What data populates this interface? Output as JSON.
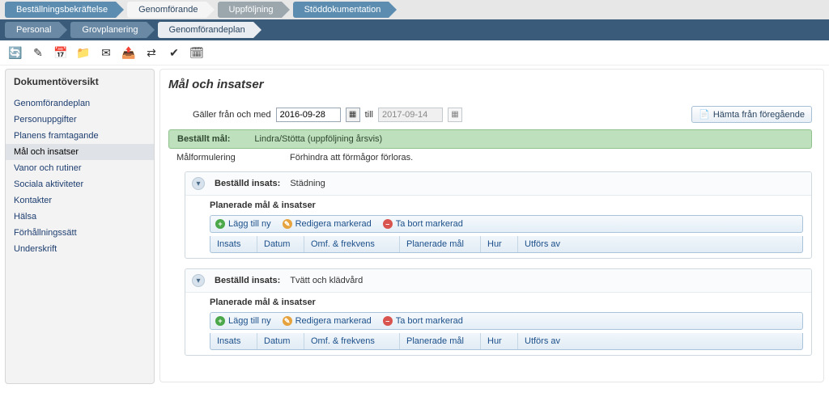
{
  "topTabs": [
    {
      "label": "Beställningsbekräftelse",
      "style": "blue"
    },
    {
      "label": "Genomförande",
      "style": "white"
    },
    {
      "label": "Uppföljning",
      "style": "gray"
    },
    {
      "label": "Stöddokumentation",
      "style": "blue"
    }
  ],
  "subTabs": [
    {
      "label": "Personal",
      "style": "plain"
    },
    {
      "label": "Grovplanering",
      "style": "plain"
    },
    {
      "label": "Genomförandeplan",
      "style": "sel"
    }
  ],
  "toolbarIcons": [
    {
      "name": "refresh-icon",
      "glyph": "🔄"
    },
    {
      "name": "edit-icon",
      "glyph": "✎"
    },
    {
      "name": "calendar-icon",
      "glyph": "📅"
    },
    {
      "name": "folder-icon",
      "glyph": "📁"
    },
    {
      "name": "mail-icon",
      "glyph": "✉"
    },
    {
      "name": "export-icon",
      "glyph": "📤"
    },
    {
      "name": "exchange-icon",
      "glyph": "⇄"
    },
    {
      "name": "check-icon",
      "glyph": "✔"
    },
    {
      "name": "schedule-icon",
      "glyph": "🗓"
    }
  ],
  "sidebar": {
    "title": "Dokumentöversikt",
    "items": [
      "Genomförandeplan",
      "Personuppgifter",
      "Planens framtagande",
      "Mål och insatser",
      "Vanor och rutiner",
      "Sociala aktiviteter",
      "Kontakter",
      "Hälsa",
      "Förhållningssätt",
      "Underskrift"
    ],
    "activeIndex": 3
  },
  "main": {
    "heading": "Mål och insatser",
    "dateRow": {
      "fromLabel": "Gäller från och med",
      "fromValue": "2016-09-28",
      "toLabel": "till",
      "toValue": "2017-09-14"
    },
    "fetchPrev": "Hämta från föregående",
    "bestallt": {
      "label": "Beställt mål:",
      "value": "Lindra/Stötta (uppföljning årsvis)"
    },
    "malform": {
      "label": "Målformulering",
      "value": "Förhindra att förmågor förloras."
    },
    "insatsLabel": "Beställd insats:",
    "planHeading": "Planerade mål & insatser",
    "actions": {
      "add": "Lägg till ny",
      "edit": "Redigera markerad",
      "del": "Ta bort markerad"
    },
    "gridCols": {
      "insats": "Insats",
      "datum": "Datum",
      "omf": "Omf. & frekvens",
      "plan": "Planerade mål",
      "hur": "Hur",
      "utf": "Utförs av"
    },
    "insatser": [
      {
        "value": "Städning"
      },
      {
        "value": "Tvätt och klädvård"
      }
    ]
  }
}
